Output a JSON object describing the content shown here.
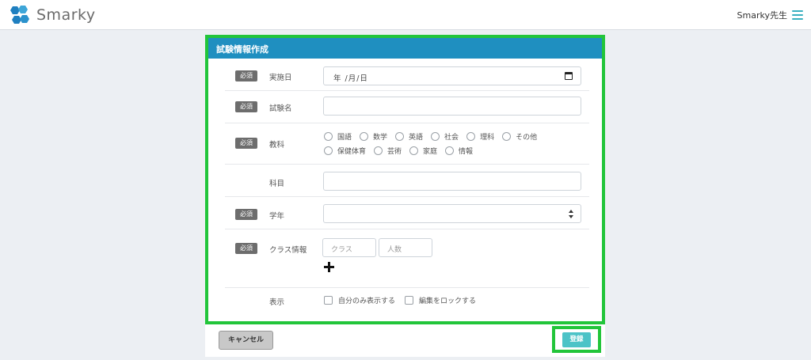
{
  "header": {
    "app_name": "Smarky",
    "user_name": "Smarky先生",
    "brand_color": "#1f8fc0"
  },
  "form": {
    "title": "試験情報作成",
    "required_badge": "必須",
    "fields": {
      "date": {
        "label": "実施日",
        "value": "年 /月/日"
      },
      "exam_name": {
        "label": "試験名",
        "value": ""
      },
      "subject": {
        "label": "教科",
        "options_row1": [
          "国語",
          "数学",
          "英語",
          "社会",
          "理科",
          "その他"
        ],
        "options_row2": [
          "保健体育",
          "芸術",
          "家庭",
          "情報"
        ]
      },
      "course": {
        "label": "科目",
        "value": ""
      },
      "grade": {
        "label": "学年",
        "value": ""
      },
      "class_info": {
        "label": "クラス情報",
        "class_placeholder": "クラス",
        "count_placeholder": "人数"
      },
      "display": {
        "label": "表示",
        "option_self_only": "自分のみ表示する",
        "option_lock": "編集をロックする"
      }
    }
  },
  "actions": {
    "cancel_label": "キャンセル",
    "register_label": "登録"
  }
}
